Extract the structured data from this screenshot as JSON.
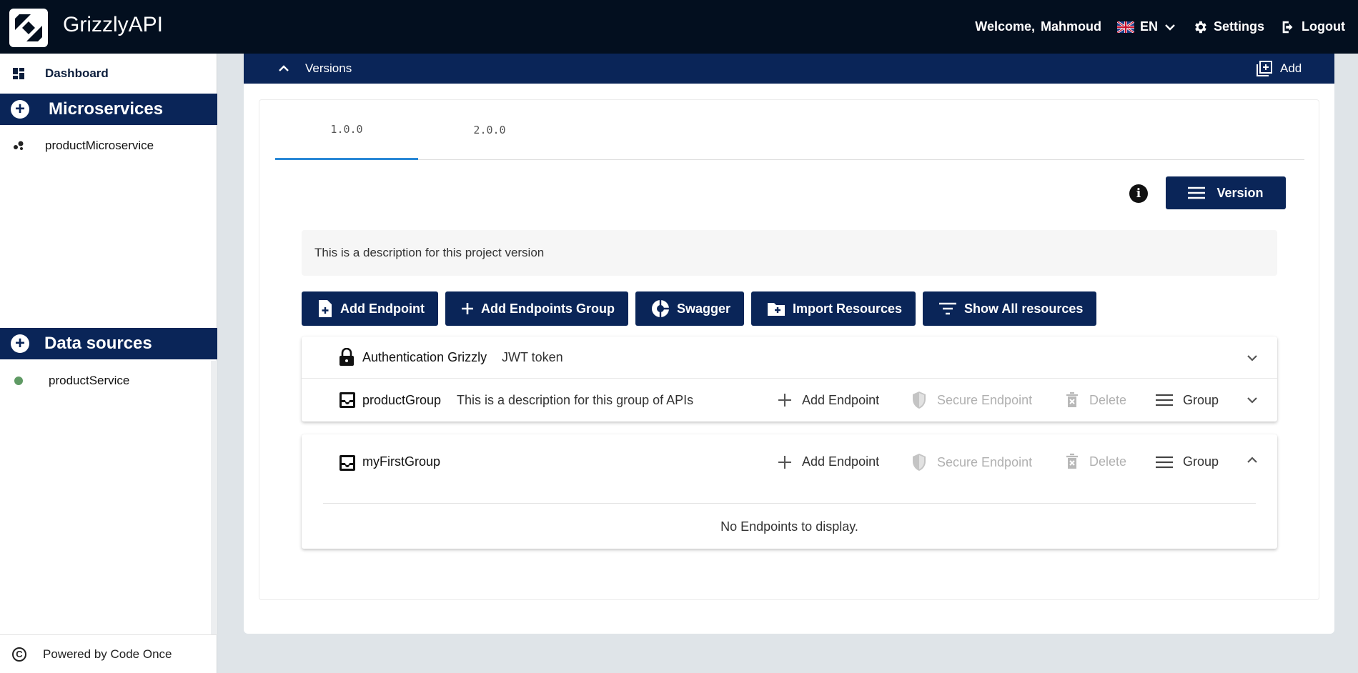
{
  "app": {
    "title": "GrizzlyAPI"
  },
  "topbar": {
    "welcome": "Welcome,",
    "user": "Mahmoud",
    "language": "EN",
    "settings_label": "Settings",
    "logout_label": "Logout"
  },
  "sidebar": {
    "dashboard_label": "Dashboard",
    "microservices_header": "Microservices",
    "microservices": [
      {
        "label": "productMicroservice"
      }
    ],
    "datasources_header": "Data sources",
    "datasources": [
      {
        "label": "productService"
      }
    ],
    "footer": "Powered by Code Once"
  },
  "versions": {
    "header": "Versions",
    "add_label": "Add",
    "tabs": [
      {
        "label": "1.0.0",
        "active": true
      },
      {
        "label": "2.0.0",
        "active": false
      }
    ],
    "version_button": "Version",
    "description": "This is a description for this project version"
  },
  "actions": {
    "add_endpoint": "Add Endpoint",
    "add_endpoints_group": "Add Endpoints Group",
    "swagger": "Swagger",
    "import_resources": "Import Resources",
    "show_all_resources": "Show All resources"
  },
  "auth": {
    "name": "Authentication Grizzly",
    "type": "JWT token"
  },
  "groups": [
    {
      "name": "productGroup",
      "description": "This is a description for this group of APIs",
      "add_endpoint": "Add Endpoint",
      "secure_endpoint": "Secure Endpoint",
      "delete": "Delete",
      "group": "Group"
    },
    {
      "name": "myFirstGroup",
      "description": "",
      "add_endpoint": "Add Endpoint",
      "secure_endpoint": "Secure Endpoint",
      "delete": "Delete",
      "group": "Group",
      "empty_message": "No Endpoints to display."
    }
  ],
  "colors": {
    "navy": "#0a2558",
    "topbar": "#030f1f",
    "tab_active": "#2a88d6"
  }
}
